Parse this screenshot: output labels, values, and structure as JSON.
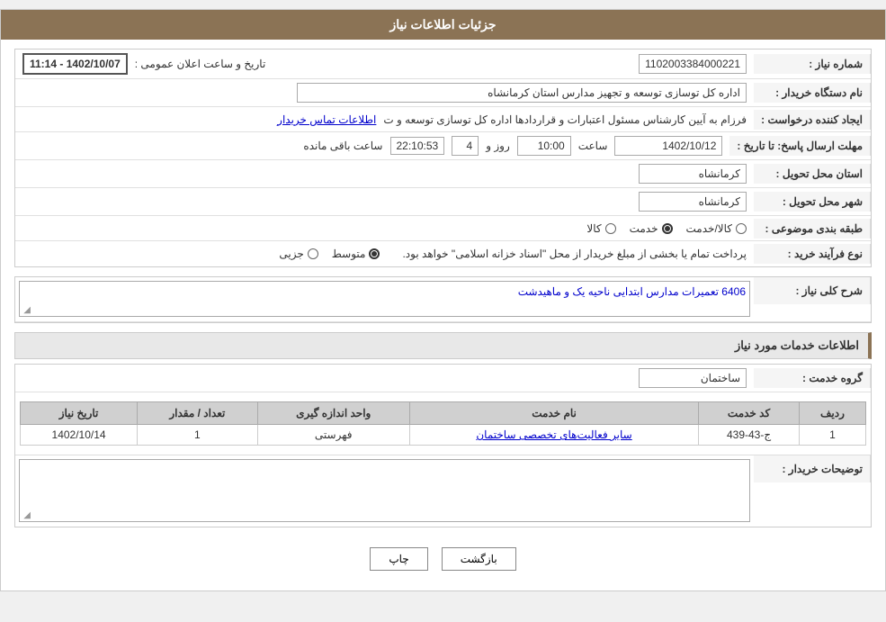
{
  "header": {
    "title": "جزئیات اطلاعات نیاز"
  },
  "need_number_label": "شماره نیاز :",
  "need_number_value": "1102003384000221",
  "buyer_org_label": "نام دستگاه خریدار :",
  "buyer_org_value": "اداره کل توسازی  توسعه و تجهیز مدارس استان کرمانشاه",
  "creator_label": "ایجاد کننده درخواست :",
  "creator_value": "فرزام به آیین کارشناس مسئول اعتبارات و قراردادها اداره کل توسازی  توسعه و ت",
  "creator_link": "اطلاعات تماس خریدار",
  "deadline_label": "مهلت ارسال پاسخ: تا تاریخ :",
  "deadline_date": "1402/10/12",
  "deadline_time_label": "ساعت",
  "deadline_time": "10:00",
  "deadline_days_label": "روز و",
  "deadline_days": "4",
  "deadline_remaining_label": "ساعت باقی مانده",
  "deadline_remaining": "22:10:53",
  "province_delivery_label": "استان محل تحویل :",
  "province_delivery_value": "کرمانشاه",
  "city_delivery_label": "شهر محل تحویل :",
  "city_delivery_value": "کرمانشاه",
  "category_label": "طبقه بندی موضوعی :",
  "category_kala": "کالا",
  "category_khadamat": "خدمت",
  "category_kala_khadamat": "کالا/خدمت",
  "category_selected": "khadamat",
  "purchase_type_label": "نوع فرآیند خرید :",
  "purchase_jozvi": "جزیی",
  "purchase_mottasat": "متوسط",
  "purchase_description": "پرداخت تمام یا بخشی از مبلغ خریدار از محل \"اسناد خزانه اسلامی\" خواهد بود.",
  "purchase_selected": "mottasat",
  "announcement_label": "تاریخ و ساعت اعلان عمومی :",
  "announcement_date_start": "1402/10/07 - 11:14",
  "need_description_section": "شرح کلی نیاز :",
  "need_description_text": "6406 تعمیرات مدارس ابتدایی ناحیه یک و ماهیدشت",
  "services_section": "اطلاعات خدمات مورد نیاز",
  "group_service_label": "گروه خدمت :",
  "group_service_value": "ساختمان",
  "services_table": {
    "headers": [
      "ردیف",
      "کد خدمت",
      "نام خدمت",
      "واحد اندازه گیری",
      "تعداد / مقدار",
      "تاریخ نیاز"
    ],
    "rows": [
      {
        "row_num": "1",
        "service_code": "ج-43-439",
        "service_name": "سایر فعالیت‌های تخصصی ساختمان",
        "unit": "فهرستی",
        "quantity": "1",
        "date": "1402/10/14"
      }
    ]
  },
  "buyer_description_label": "توضیحات خریدار :",
  "buttons": {
    "print": "چاپ",
    "back": "بازگشت"
  }
}
